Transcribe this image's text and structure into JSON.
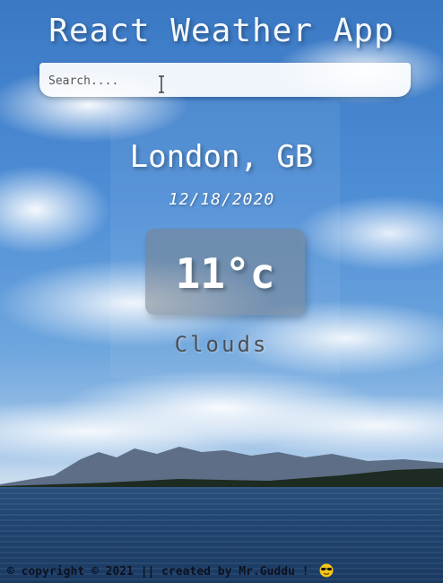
{
  "app": {
    "title": "React Weather App"
  },
  "search": {
    "placeholder": "Search...."
  },
  "weather": {
    "location": "London, GB",
    "date": "12/18/2020",
    "temperature": "11°c",
    "condition": "Clouds"
  },
  "footer": {
    "text": "© copyright © 2021 || created by Mr.Guddu !",
    "emoji_icon": "sunglasses-emoji-icon"
  },
  "colors": {
    "sky": "#4f8fd6",
    "lake": "#20446f",
    "condition_text": "#4a4f55"
  }
}
